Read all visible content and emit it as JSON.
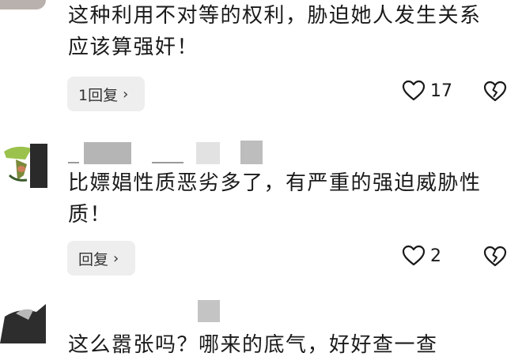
{
  "comments": [
    {
      "text_lines": [
        "这种利用不对等的权利，胁迫她人发生关系",
        "应该算强奸！"
      ],
      "reply_label": "1回复",
      "like_count": "17"
    },
    {
      "text_lines": [
        "比嫖娼性质恶劣多了，有严重的强迫威胁性",
        "质！"
      ],
      "reply_label": "回复",
      "like_count": "2"
    },
    {
      "text_lines": [
        "这么嚣张吗？哪来的底气，好好查一查"
      ]
    }
  ],
  "icons": {
    "like": "heart-icon",
    "dislike": "broken-heart-icon",
    "reply_chevron": "chevron-right-icon"
  },
  "colors": {
    "background": "#ffffff",
    "reply_button_bg": "#eeeeee",
    "text": "#1a1a1a"
  }
}
